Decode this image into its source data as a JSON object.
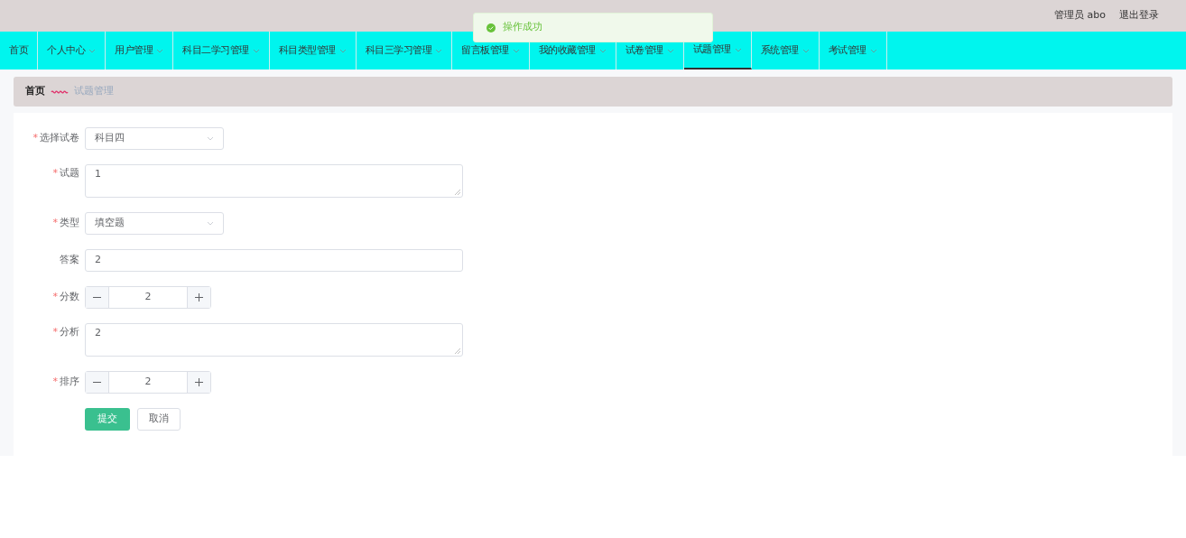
{
  "header": {
    "user": "管理员 abo",
    "logout": "退出登录"
  },
  "toast": {
    "message": "操作成功"
  },
  "nav": [
    {
      "label": "首页",
      "dropdown": false,
      "selected": false
    },
    {
      "label": "个人中心",
      "dropdown": true,
      "selected": false
    },
    {
      "label": "用户管理",
      "dropdown": true,
      "selected": false
    },
    {
      "label": "科目二学习管理",
      "dropdown": true,
      "selected": false
    },
    {
      "label": "科目类型管理",
      "dropdown": true,
      "selected": false
    },
    {
      "label": "科目三学习管理",
      "dropdown": true,
      "selected": false
    },
    {
      "label": "留言板管理",
      "dropdown": true,
      "selected": false
    },
    {
      "label": "我的收藏管理",
      "dropdown": true,
      "selected": false
    },
    {
      "label": "试卷管理",
      "dropdown": true,
      "selected": false
    },
    {
      "label": "试题管理",
      "dropdown": true,
      "selected": true
    },
    {
      "label": "系统管理",
      "dropdown": true,
      "selected": false
    },
    {
      "label": "考试管理",
      "dropdown": true,
      "selected": false
    }
  ],
  "breadcrumb": [
    {
      "label": "首页"
    },
    {
      "label": "试题管理"
    }
  ],
  "form": [
    {
      "kind": "select",
      "label": "选择试卷",
      "marker": "*",
      "value": "科目四"
    },
    {
      "kind": "textarea",
      "label": "试题",
      "marker": "*",
      "value": "1"
    },
    {
      "kind": "select",
      "label": "类型",
      "marker": "*",
      "value": "填空题"
    },
    {
      "kind": "input",
      "label": "答案",
      "value": "2"
    },
    {
      "kind": "number",
      "label": "分数",
      "marker": "*",
      "value": "2"
    },
    {
      "kind": "textarea",
      "label": "分析",
      "marker": "*",
      "value": "2"
    },
    {
      "kind": "number",
      "label": "排序",
      "marker": "*",
      "value": "2"
    }
  ],
  "buttons": [
    {
      "label": "提交",
      "kind": "primary"
    },
    {
      "label": "取消",
      "kind": "default"
    }
  ]
}
